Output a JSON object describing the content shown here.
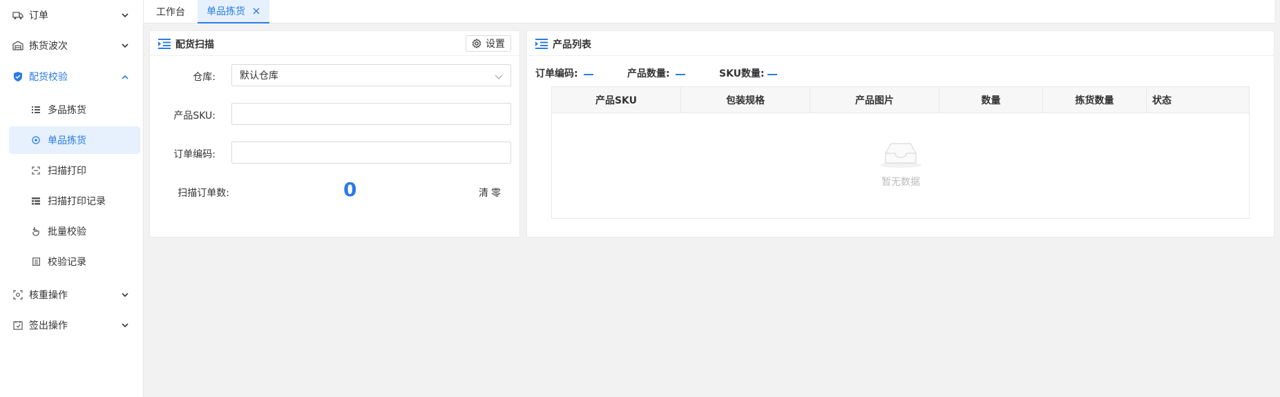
{
  "sidebar": {
    "items": [
      {
        "label": "订单",
        "icon": "truck-icon"
      },
      {
        "label": "拣货波次",
        "icon": "warehouse-icon"
      },
      {
        "label": "配货校验",
        "icon": "shield-check-icon"
      },
      {
        "label": "核重操作",
        "icon": "scale-icon"
      },
      {
        "label": "签出操作",
        "icon": "sign-out-icon"
      }
    ],
    "subitems": [
      {
        "label": "多品拣货",
        "icon": "list-icon"
      },
      {
        "label": "单品拣货",
        "icon": "target-icon"
      },
      {
        "label": "扫描打印",
        "icon": "scan-icon"
      },
      {
        "label": "扫描打印记录",
        "icon": "list-detail-icon"
      },
      {
        "label": "批量校验",
        "icon": "hand-icon"
      },
      {
        "label": "校验记录",
        "icon": "document-icon"
      }
    ]
  },
  "tabs": [
    {
      "label": "工作台"
    },
    {
      "label": "单品拣货"
    }
  ],
  "scan_panel": {
    "title": "配货扫描",
    "settings_label": "设置",
    "warehouse_label": "仓库:",
    "warehouse_value": "默认仓库",
    "sku_label": "产品SKU:",
    "sku_value": "",
    "order_label": "订单编码:",
    "order_value": "",
    "scan_count_label": "扫描订单数:",
    "scan_count_value": "0",
    "clear_label": "清零"
  },
  "product_panel": {
    "title": "产品列表",
    "stats": {
      "order_code_label": "订单编码:",
      "product_qty_label": "产品数量:",
      "sku_qty_label": "SKU数量:"
    },
    "columns": [
      "产品SKU",
      "包装规格",
      "产品图片",
      "数量",
      "拣货数量",
      "状态"
    ],
    "empty_text": "暂无数据"
  },
  "colors": {
    "accent": "#2a7be4",
    "active_bg": "#e6f1fd"
  }
}
